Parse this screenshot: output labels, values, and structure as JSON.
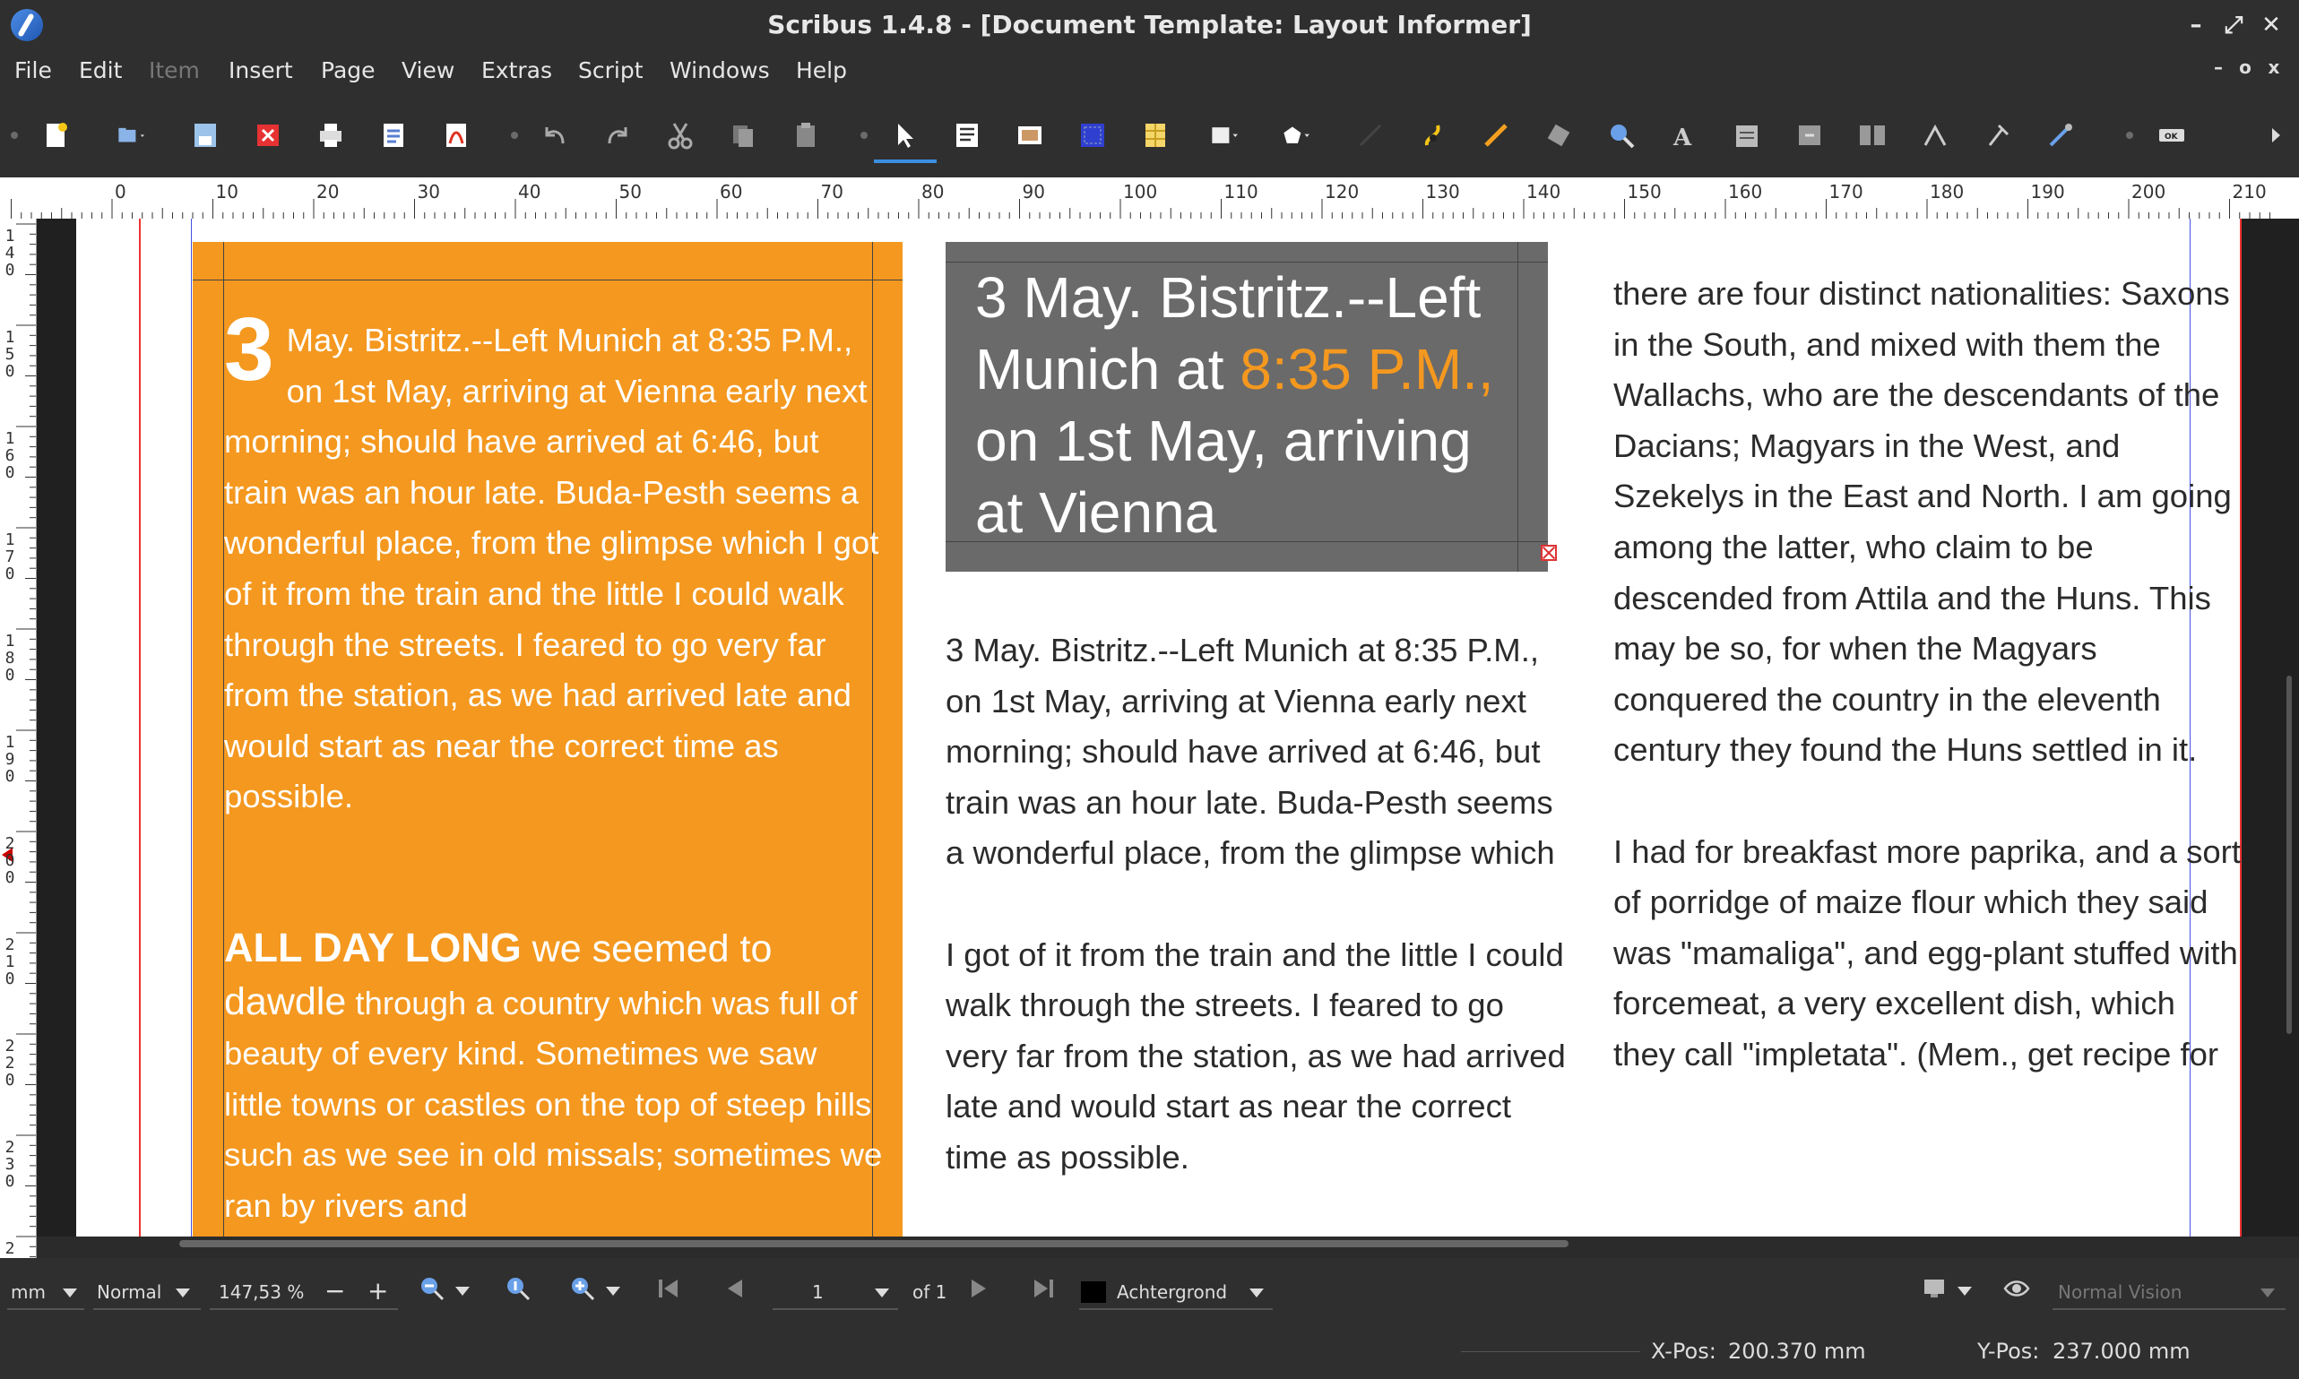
{
  "window": {
    "title": "Scribus 1.4.8 - [Document Template: Layout Informer]",
    "controls": [
      "–",
      "⤢",
      "✕"
    ]
  },
  "menubar": {
    "items": [
      {
        "label": "File",
        "enabled": true
      },
      {
        "label": "Edit",
        "enabled": true
      },
      {
        "label": "Item",
        "enabled": false
      },
      {
        "label": "Insert",
        "enabled": true
      },
      {
        "label": "Page",
        "enabled": true
      },
      {
        "label": "View",
        "enabled": true
      },
      {
        "label": "Extras",
        "enabled": true
      },
      {
        "label": "Script",
        "enabled": true
      },
      {
        "label": "Windows",
        "enabled": true
      },
      {
        "label": "Help",
        "enabled": true
      }
    ],
    "mdi_controls": [
      "–",
      "o",
      "x"
    ]
  },
  "ruler": {
    "horizontal_labels": [
      "0",
      "10",
      "20",
      "30",
      "40",
      "50",
      "60",
      "70",
      "80",
      "90",
      "100",
      "110",
      "120",
      "130",
      "140",
      "150",
      "160",
      "170",
      "180",
      "190",
      "200",
      "210"
    ],
    "vertical_labels": [
      "140",
      "150",
      "160",
      "170",
      "180",
      "190",
      "200",
      "210",
      "220",
      "230",
      "2"
    ]
  },
  "document": {
    "left_frame": {
      "dropcap": "3",
      "para1": "May. Bistritz.--Left Munich at 8:35 P.M., on 1st May, arriving at Vienna early next morning; should have arrived at 6:46, but train was an hour late. Buda-Pesth seems a wonderful place, from the glimpse which I got of it from the train and the little I could walk through the streets. I feared to go very far from the station, as we had arrived late and would start as near the correct time as possible.",
      "para2_lead_bold": "ALL DAY LONG",
      "para2_lead": " we seemed to ",
      "para2_lead2": "dawdle",
      "para2_rest": " through a country which was full of beauty of every kind. Sometimes we saw little towns or castles on the top of steep hills such as we see in old missals; sometimes we ran by rivers and"
    },
    "gray_frame": {
      "text_a": "3 May. Bistritz.--Left Munich at ",
      "text_accent": "8:35 P.M.,",
      "text_b": " on 1st May, arriving at Vienna"
    },
    "middle_column": {
      "para1": "3 May. Bistritz.--Left Munich at 8:35 P.M., on 1st May, arriving at Vienna early next morning; should have arrived at 6:46, but train was an hour late. Buda-Pesth seems a wonderful place, from the glimpse which",
      "para2": "I got of it from the train and the little I could walk through the streets. I feared to go very far from the station, as we had arrived late and would start as near the correct time as possible."
    },
    "right_column": {
      "para1": "there are four distinct nationalities: Saxons in the South, and mixed with them the Wallachs, who are the descendants of the Dacians; Magyars in the West, and Szekelys in the East and North. I am going among the latter, who claim to be descended from Attila and the Huns. This may be so, for when the Magyars conquered the country in the eleventh century they found the Huns settled in it.",
      "para2": "I had for breakfast more paprika, and a sort of porridge of maize flour which they said was \"mamaliga\", and egg-plant stuffed with forcemeat, a very excellent dish, which they call \"impletata\". (Mem., get recipe for"
    },
    "colors": {
      "accent": "#f4981f",
      "gray_frame": "#6a6a6a"
    }
  },
  "statusbar": {
    "unit": "mm",
    "preview_mode": "Normal",
    "zoom": "147,53 %",
    "zoom_minus": "−",
    "zoom_plus": "+",
    "current_page": "1",
    "page_of": "of 1",
    "layer": "Achtergrond",
    "vision": "Normal Vision",
    "xpos_label": "X-Pos:",
    "xpos_value": "200.370 mm",
    "ypos_label": "Y-Pos:",
    "ypos_value": "237.000 mm"
  }
}
